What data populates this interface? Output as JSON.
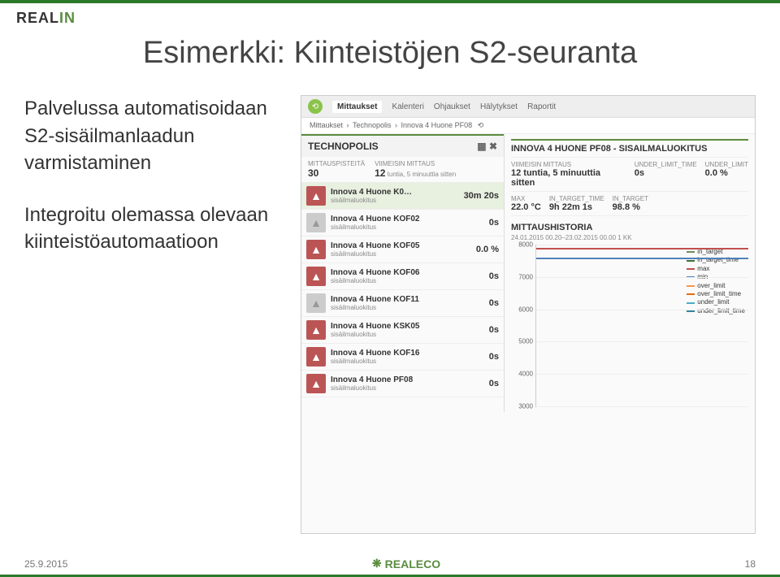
{
  "logo": {
    "part1": "REAL",
    "part2": "IN"
  },
  "title": "Esimerkki: Kiinteistöjen S2-seuranta",
  "body_text": {
    "p1": "Palvelussa automatisoidaan S2-sisäilmanlaadun varmistaminen",
    "p2": "Integroitu olemassa olevaan kiinteistöautomaatioon"
  },
  "app": {
    "tabs": [
      "Mittaukset",
      "Kalenteri",
      "Ohjaukset",
      "Hälytykset",
      "Raportit"
    ],
    "breadcrumb": [
      "Mittaukset",
      "Technopolis",
      "Innova 4 Huone PF08"
    ],
    "left_panel": {
      "title": "TECHNOPOLIS",
      "stat1_label": "MITTAUSPISTEITÄ",
      "stat1_value": "30",
      "stat2_label": "VIIMEISIN MITTAUS",
      "stat2_value": "12",
      "stat2_suffix": "tuntia, 5 minuuttia sitten"
    },
    "rooms": [
      {
        "name": "Innova 4 Huone K0…",
        "sub": "sisäilmaluokitus",
        "val": "30m 20s",
        "grey": false,
        "sel": true
      },
      {
        "name": "Innova 4 Huone KOF02",
        "sub": "sisäilmaluokitus",
        "val": "0s",
        "grey": true,
        "sel": false
      },
      {
        "name": "Innova 4 Huone KOF05",
        "sub": "sisäilmaluokitus",
        "val": "0.0 %",
        "grey": false,
        "sel": false
      },
      {
        "name": "Innova 4 Huone KOF06",
        "sub": "sisäilmaluokitus",
        "val": "0s",
        "grey": false,
        "sel": false
      },
      {
        "name": "Innova 4 Huone KOF11",
        "sub": "sisäilmaluokitus",
        "val": "0s",
        "grey": true,
        "sel": false
      },
      {
        "name": "Innova 4 Huone KSK05",
        "sub": "sisäilmaluokitus",
        "val": "0s",
        "grey": false,
        "sel": false
      },
      {
        "name": "Innova 4 Huone KOF16",
        "sub": "sisäilmaluokitus",
        "val": "0s",
        "grey": false,
        "sel": false
      },
      {
        "name": "Innova 4 Huone PF08",
        "sub": "sisäilmaluokitus",
        "val": "0s",
        "grey": false,
        "sel": false
      }
    ],
    "right_panel": {
      "title": "INNOVA 4 HUONE PF08 - SISAILMALUOKITUS",
      "row1": [
        {
          "label": "VIIMEISIN MITTAUS",
          "val": "12 tuntia, 5 minuuttia sitten"
        },
        {
          "label": "UNDER_LIMIT_TIME",
          "val": "0s"
        },
        {
          "label": "UNDER_LIMIT",
          "val": "0.0 %"
        }
      ],
      "row2": [
        {
          "label": "MAX",
          "val": "22.0 °C"
        },
        {
          "label": "IN_TARGET_TIME",
          "val": "9h 22m 1s"
        },
        {
          "label": "IN_TARGET",
          "val": "98.8 %"
        }
      ]
    },
    "chart": {
      "title": "MITTAUSHISTORIA",
      "subtitle": "24.01.2015 00.20–23.02.2015 00.00 1 KK"
    }
  },
  "chart_data": {
    "type": "line",
    "title": "MITTAUSHISTORIA",
    "xlabel": "",
    "ylabel": "",
    "ylim": [
      3000,
      8000
    ],
    "y_ticks": [
      3000,
      4000,
      5000,
      6000,
      7000,
      8000
    ],
    "series": [
      {
        "name": "in_target",
        "color": "#6b8e5a"
      },
      {
        "name": "in_target_time",
        "color": "#3b6e3b"
      },
      {
        "name": "max",
        "color": "#c0504d"
      },
      {
        "name": "min",
        "color": "#4f81bd"
      },
      {
        "name": "over_limit",
        "color": "#f79646"
      },
      {
        "name": "over_limit_time",
        "color": "#e46c0a"
      },
      {
        "name": "under_limit",
        "color": "#4bacc6"
      },
      {
        "name": "under_limit_time",
        "color": "#31859b"
      }
    ],
    "visible_lines": [
      {
        "name": "max",
        "color": "#c0504d",
        "approx_y": 7900
      },
      {
        "name": "min",
        "color": "#4f81bd",
        "approx_y": 7600
      }
    ]
  },
  "footer": {
    "date": "25.9.2015",
    "brand": "REALECO",
    "page": "18"
  }
}
